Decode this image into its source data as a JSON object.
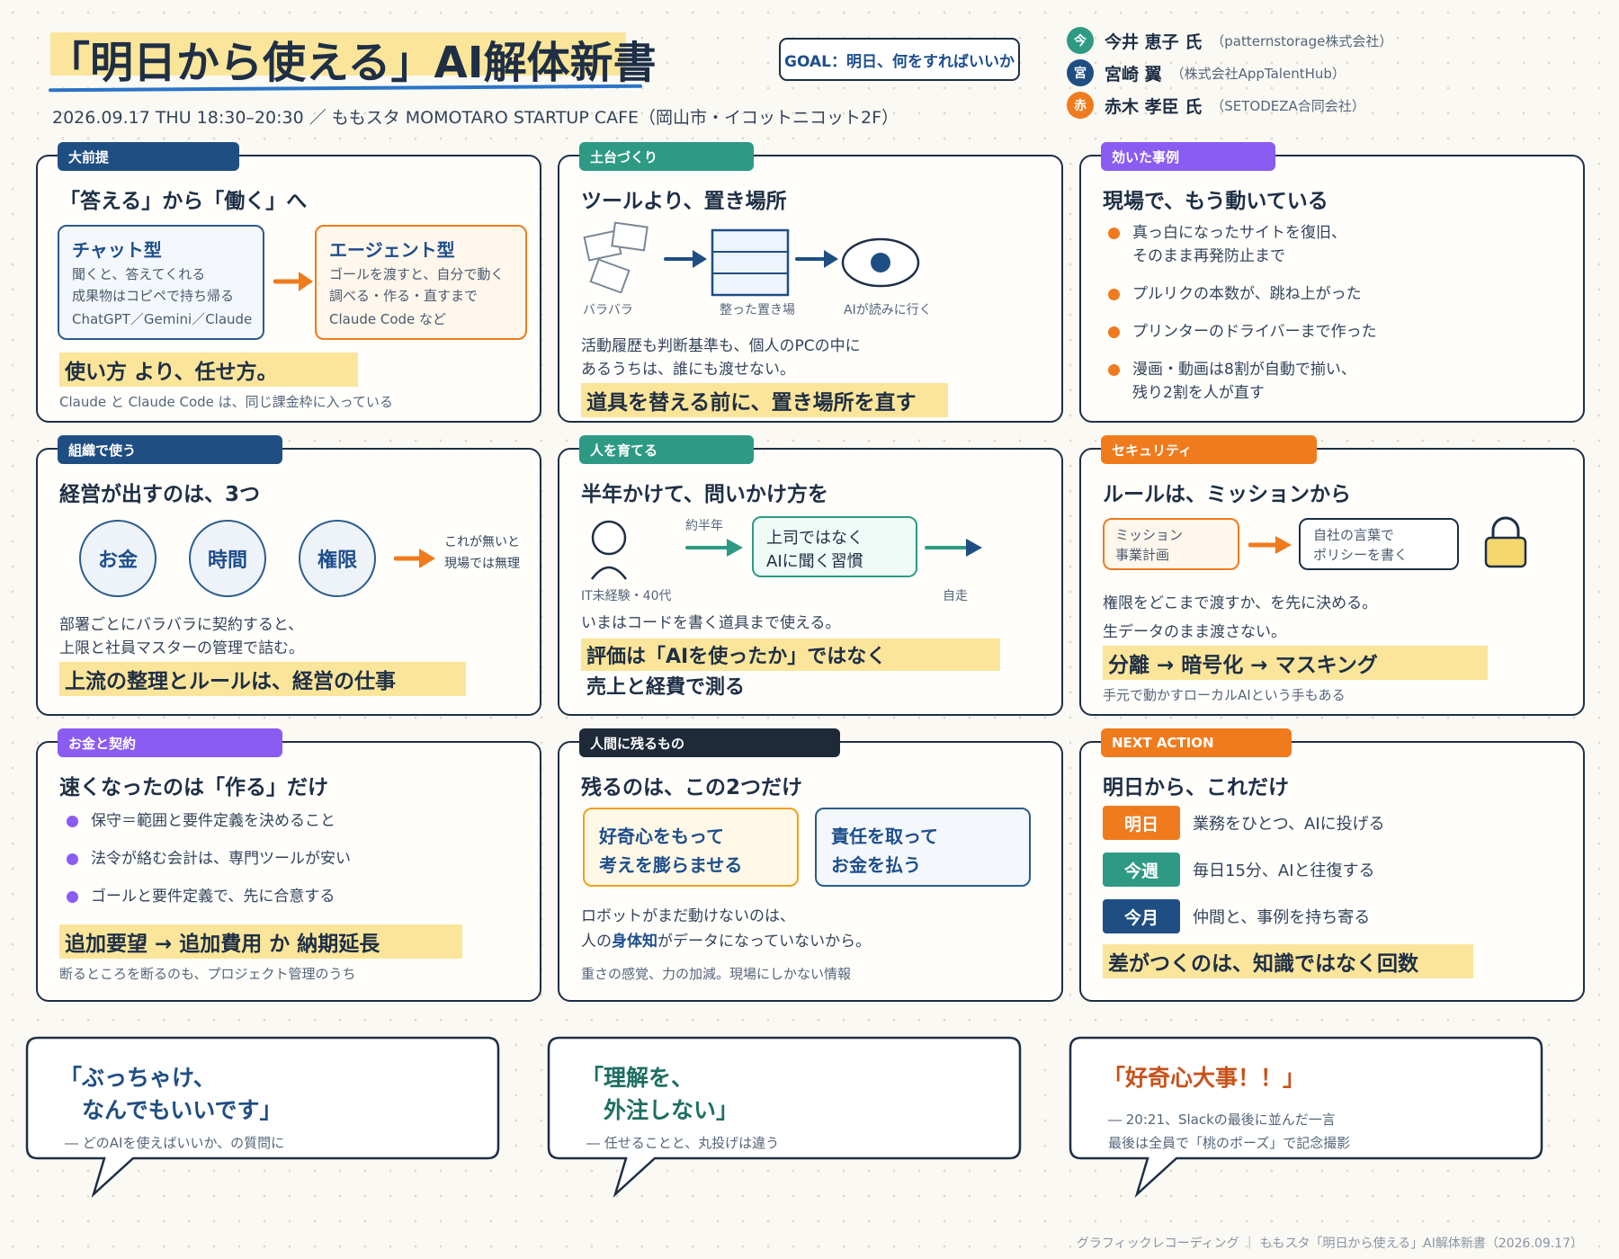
{
  "header": {
    "title": "「明日から使える」AI解体新書",
    "event_info": "2026.09.17 THU 18:30–20:30 ／ ももスタ MOMOTARO STARTUP CAFE（岡山市・イコットニコット2F）",
    "goal": "GOAL：明日、何をすればいいか"
  },
  "speakers": [
    {
      "mark": "今",
      "name": "今井 恵子 氏",
      "org": "（patternstorage株式会社）",
      "color": "#2e9a84"
    },
    {
      "mark": "宮",
      "name": "宮崎 翼",
      "org": "（株式会社AppTalentHub）",
      "color": "#1f4e83"
    },
    {
      "mark": "赤",
      "name": "赤木 孝臣 氏",
      "org": "（SETODEZA合同会社）",
      "color": "#f07b1d"
    }
  ],
  "colors": {
    "navy": "#1f4e83",
    "teal": "#2e9a84",
    "purple": "#8a5cf2",
    "orange": "#f07b1d",
    "dark": "#1e2a38",
    "highlight": "#fbe59a"
  },
  "panels": {
    "premise": {
      "tag": "大前提",
      "title": "「答える」から「働く」へ",
      "chat": {
        "title": "チャット型",
        "l1": "聞くと、答えてくれる",
        "l2": "成果物はコピペで持ち帰る",
        "l3": "ChatGPT／Gemini／Claude"
      },
      "agent": {
        "title": "エージェント型",
        "l1": "ゴールを渡すと、自分で動く",
        "l2": "調べる・作る・直すまで",
        "l3": "Claude Code など"
      },
      "highlight": "使い方 より、任せ方。",
      "note": "Claude と Claude Code は、同じ課金枠に入っている"
    },
    "foundation": {
      "tag": "土台づくり",
      "title": "ツールより、置き場所",
      "label_scattered": "バラバラ",
      "label_organized": "整った置き場",
      "label_ai": "AIが読みに行く",
      "body1": "活動履歴も判断基準も、個人のPCの中に",
      "body2": "あるうちは、誰にも渡せない。",
      "highlight": "道具を替える前に、置き場所を直す"
    },
    "cases": {
      "tag": "効いた事例",
      "title": "現場で、もう動いている",
      "items": [
        {
          "l1": "真っ白になったサイトを復旧、",
          "l2": "そのまま再発防止まで"
        },
        {
          "l1": "プルリクの本数が、跳ね上がった",
          "l2": ""
        },
        {
          "l1": "プリンターのドライバーまで作った",
          "l2": ""
        },
        {
          "l1": "漫画・動画は8割が自動で揃い、",
          "l2": "残り2割を人が直す"
        }
      ]
    },
    "org": {
      "tag": "組織で使う",
      "title": "経営が出すのは、3つ",
      "circles": [
        "お金",
        "時間",
        "権限"
      ],
      "note1": "これが無いと",
      "note2": "現場では無理",
      "body1": "部署ごとにバラバラに契約すると、",
      "body2": "上限と社員マスターの管理で詰む。",
      "highlight": "上流の整理とルールは、経営の仕事"
    },
    "people": {
      "tag": "人を育てる",
      "title": "半年かけて、問いかけ方を",
      "duration": "約半年",
      "box1": "上司ではなく",
      "box2": "AIに聞く習慣",
      "person_label": "IT未経験・40代",
      "result": "自走",
      "body": "いまはコードを書く道具まで使える。",
      "highlight1": "評価は「AIを使ったか」ではなく",
      "highlight2": "売上と経費で測る"
    },
    "security": {
      "tag": "セキュリティ",
      "title": "ルールは、ミッションから",
      "box1a": "ミッション",
      "box1b": "事業計画",
      "box2a": "自社の言葉で",
      "box2b": "ポリシーを書く",
      "body1": "権限をどこまで渡すか、を先に決める。",
      "body2": "生データのまま渡さない。",
      "highlight": "分離 → 暗号化 → マスキング",
      "note": "手元で動かすローカルAIという手もある"
    },
    "money": {
      "tag": "お金と契約",
      "title": "速くなったのは「作る」だけ",
      "items": [
        "保守＝範囲と要件定義を決めること",
        "法令が絡む会計は、専門ツールが安い",
        "ゴールと要件定義で、先に合意する"
      ],
      "highlight": "追加要望 → 追加費用 か 納期延長",
      "note": "断るところを断るのも、プロジェクト管理のうち"
    },
    "human": {
      "tag": "人間に残るもの",
      "title": "残るのは、この2つだけ",
      "box1a": "好奇心をもって",
      "box1b": "考えを膨らませる",
      "box2a": "責任を取って",
      "box2b": "お金を払う",
      "body1": "ロボットがまだ動けないのは、",
      "body2a": "人の",
      "body2b": "身体知",
      "body2c": "がデータになっていないから。",
      "note": "重さの感覚、力の加減。現場にしかない情報"
    },
    "next": {
      "tag": "NEXT ACTION",
      "title": "明日から、これだけ",
      "actions": [
        {
          "label": "明日",
          "text": "業務をひとつ、AIに投げる"
        },
        {
          "label": "今週",
          "text": "毎日15分、AIと往復する"
        },
        {
          "label": "今月",
          "text": "仲間と、事例を持ち寄る"
        }
      ],
      "highlight": "差がつくのは、知識ではなく回数"
    }
  },
  "quotes": [
    {
      "l1": "「ぶっちゃけ、",
      "l2": "　なんでもいいです」",
      "s1": "― どのAIを使えばいいか、の質問に",
      "s2": ""
    },
    {
      "l1": "「理解を、",
      "l2": "　外注しない」",
      "s1": "― 任せることと、丸投げは違う",
      "s2": ""
    },
    {
      "l1": "「好奇心大事！！」",
      "l2": "",
      "s1": "― 20:21、Slackの最後に並んだ一言",
      "s2": "最後は全員で「桃のポーズ」で記念撮影"
    }
  ],
  "footer": "グラフィックレコーディング ｜ ももスタ「明日から使える」AI解体新書（2026.09.17）"
}
